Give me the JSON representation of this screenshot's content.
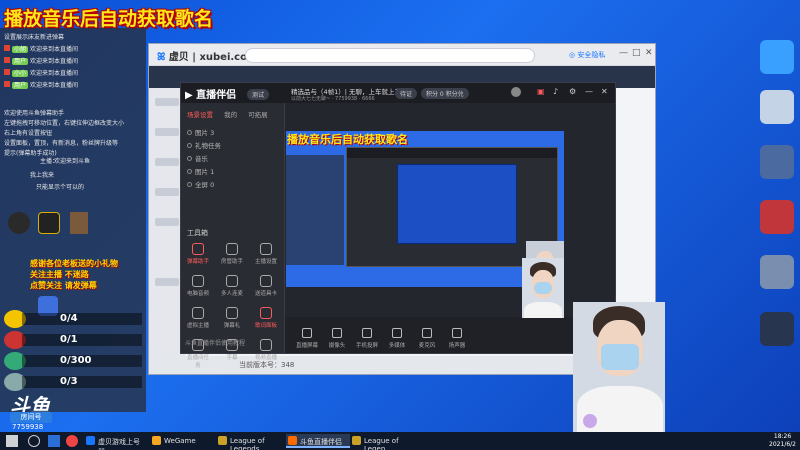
{
  "overlay_title": "播放音乐后自动获取歌名",
  "browser": {
    "logo_text": "虚贝",
    "url": "xubei.com",
    "security_btn": "◎ 安全隐私",
    "footer": "当前版本号：348"
  },
  "live_companion": {
    "name": "直播伴侣",
    "beta": "测试",
    "account": "精选品与（4帧1）| 无聊，上车就上车",
    "account_btn1": "待证",
    "account_btn2": "积分 0 积分兑",
    "subline": "以前大七七无聊~ · 7759938 · 6666",
    "tabs": [
      "场景设置",
      "我的",
      "可拓展"
    ],
    "scenes": [
      "图片 3",
      "礼物任务",
      "音乐",
      "图片 1",
      "全屏 0"
    ],
    "tools_title": "工具箱",
    "tools": [
      "弹幕助手",
      "房管助手",
      "主播设置",
      "电脑音频",
      "多人连麦",
      "送道具卡",
      "虚拟主播",
      "弹幕礼",
      "歌词面板",
      "直播间任务",
      "字幕",
      "视频直播"
    ],
    "bottom_tools": [
      "直播屏幕",
      "摄像头",
      "手机投屏",
      "多媒体",
      "麦克风",
      "扬声器"
    ],
    "status": "斗鱼直播伴侣使用教程"
  },
  "preview_title": "播放音乐后自动获取歌名",
  "chat": {
    "header": "设置展示床友新进弹幕",
    "lines": [
      {
        "user": "小胡",
        "text": "欢迎来到本直播间"
      },
      {
        "user": "用户",
        "text": "欢迎来到本直播间"
      },
      {
        "user": "小小",
        "text": "欢迎来到本直播间"
      },
      {
        "user": "用户",
        "text": "欢迎来到本直播间"
      }
    ],
    "notice": [
      "欢迎使用斗鱼弹幕助手",
      "左键拖拽可移动位置，右键拉伸边框改变大小",
      "右上角有设置按钮",
      "设置面板，置顶，有新消息，粉丝牌升级等",
      "提示(弹幕助手成功)"
    ],
    "mid_lines": [
      "主播：",
      "欢迎来到斗鱼",
      "我上我来",
      "只能显示个可以的"
    ],
    "gift_notice": [
      "感谢各位老板送的小礼物",
      "关注主播 不迷路",
      "点赞关注 请发弹幕"
    ],
    "gift_rows": [
      {
        "value": "0/4",
        "color": "#f3c400"
      },
      {
        "value": "0/1",
        "color": "#c33"
      },
      {
        "value": "0/300",
        "color": "#3a7"
      },
      {
        "value": "0/3",
        "color": "#8aa"
      }
    ]
  },
  "branding": {
    "douyu": "斗鱼",
    "host_badge": "房间号",
    "room_id": "7759938"
  },
  "taskbar": {
    "items": [
      {
        "label": "虚贝游戏上号器",
        "color": "#1a76ff"
      },
      {
        "label": "WeGame",
        "color": "#f5a623"
      },
      {
        "label": "League of Legends",
        "color": "#c9a227"
      },
      {
        "label": "斗鱼直播伴侣",
        "color": "#ff6a00"
      },
      {
        "label": "League of Legen...",
        "color": "#c9a227"
      }
    ],
    "time": "18:26",
    "date": "2021/6/2"
  }
}
